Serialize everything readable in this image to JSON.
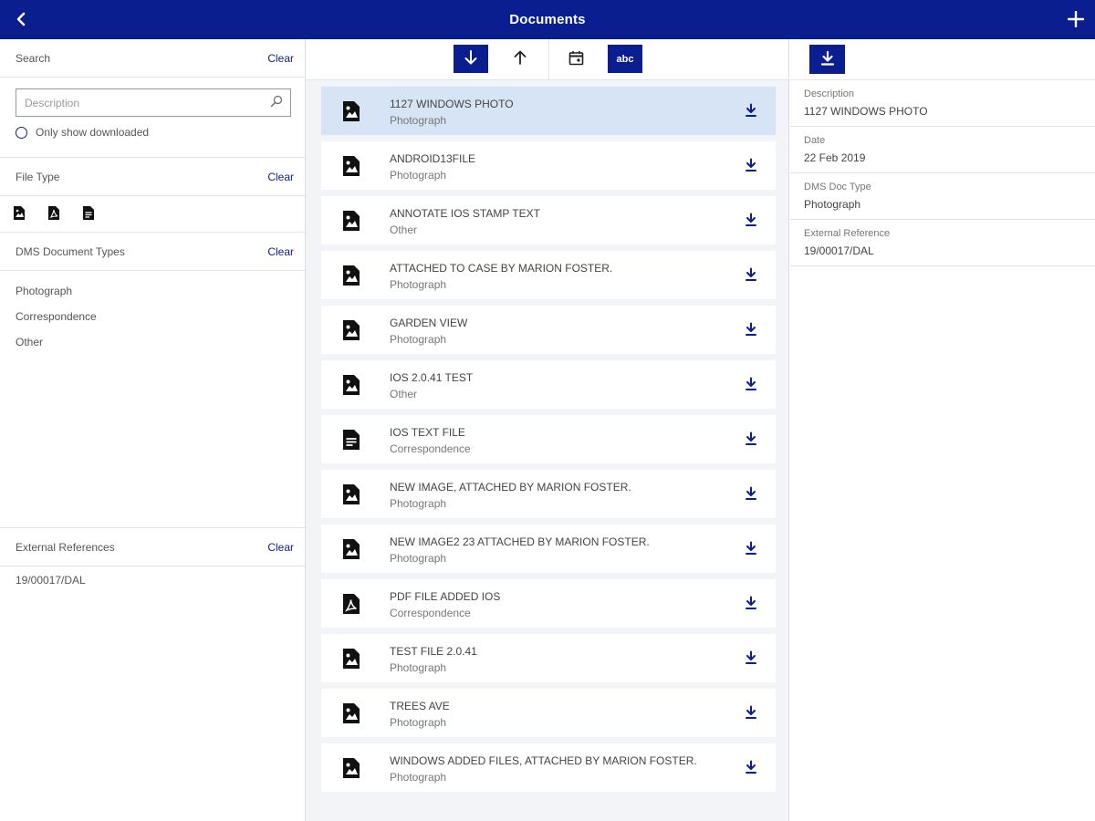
{
  "header": {
    "title": "Documents"
  },
  "left": {
    "search": {
      "label": "Search",
      "clear": "Clear",
      "placeholder": "Description",
      "only_downloaded": "Only show downloaded"
    },
    "file_type": {
      "label": "File Type",
      "clear": "Clear",
      "icons": [
        "image-file-icon",
        "pdf-file-icon",
        "text-file-icon"
      ]
    },
    "dms": {
      "label": "DMS Document Types",
      "clear": "Clear",
      "items": [
        "Photograph",
        "Correspondence",
        "Other"
      ]
    },
    "external": {
      "label": "External References",
      "clear": "Clear",
      "value": "19/00017/DAL"
    }
  },
  "toolbar": {
    "sort_desc": "sort-descending-icon",
    "sort_asc": "sort-ascending-icon",
    "calendar": "calendar-icon",
    "abc": "abc"
  },
  "documents": [
    {
      "name": "1127 WINDOWS PHOTO",
      "type": "Photograph",
      "icon": "image"
    },
    {
      "name": "ANDROID13FILE",
      "type": "Photograph",
      "icon": "image"
    },
    {
      "name": "ANNOTATE IOS STAMP TEXT",
      "type": "Other",
      "icon": "image"
    },
    {
      "name": "ATTACHED TO CASE BY MARION FOSTER.",
      "type": "Photograph",
      "icon": "image"
    },
    {
      "name": "GARDEN VIEW",
      "type": "Photograph",
      "icon": "image"
    },
    {
      "name": "IOS 2.0.41 TEST",
      "type": "Other",
      "icon": "image"
    },
    {
      "name": "IOS TEXT FILE",
      "type": "Correspondence",
      "icon": "text"
    },
    {
      "name": "NEW IMAGE, ATTACHED BY MARION FOSTER.",
      "type": "Photograph",
      "icon": "image"
    },
    {
      "name": "NEW IMAGE2 23 ATTACHED BY MARION FOSTER.",
      "type": "Photograph",
      "icon": "image"
    },
    {
      "name": "PDF FILE ADDED IOS",
      "type": "Correspondence",
      "icon": "pdf"
    },
    {
      "name": "TEST FILE 2.0.41",
      "type": "Photograph",
      "icon": "image"
    },
    {
      "name": "TREES AVE",
      "type": "Photograph",
      "icon": "image"
    },
    {
      "name": "WINDOWS ADDED FILES, ATTACHED BY MARION FOSTER.",
      "type": "Photograph",
      "icon": "image"
    }
  ],
  "details": [
    {
      "label": "Description",
      "value": "1127 WINDOWS PHOTO"
    },
    {
      "label": "Date",
      "value": "22 Feb 2019"
    },
    {
      "label": "DMS Doc Type",
      "value": "Photograph"
    },
    {
      "label": "External Reference",
      "value": "19/00017/DAL"
    }
  ],
  "colors": {
    "primary": "#0a1e8f",
    "selected_row": "#d6e4f5",
    "list_bg": "#f3f4f7"
  }
}
